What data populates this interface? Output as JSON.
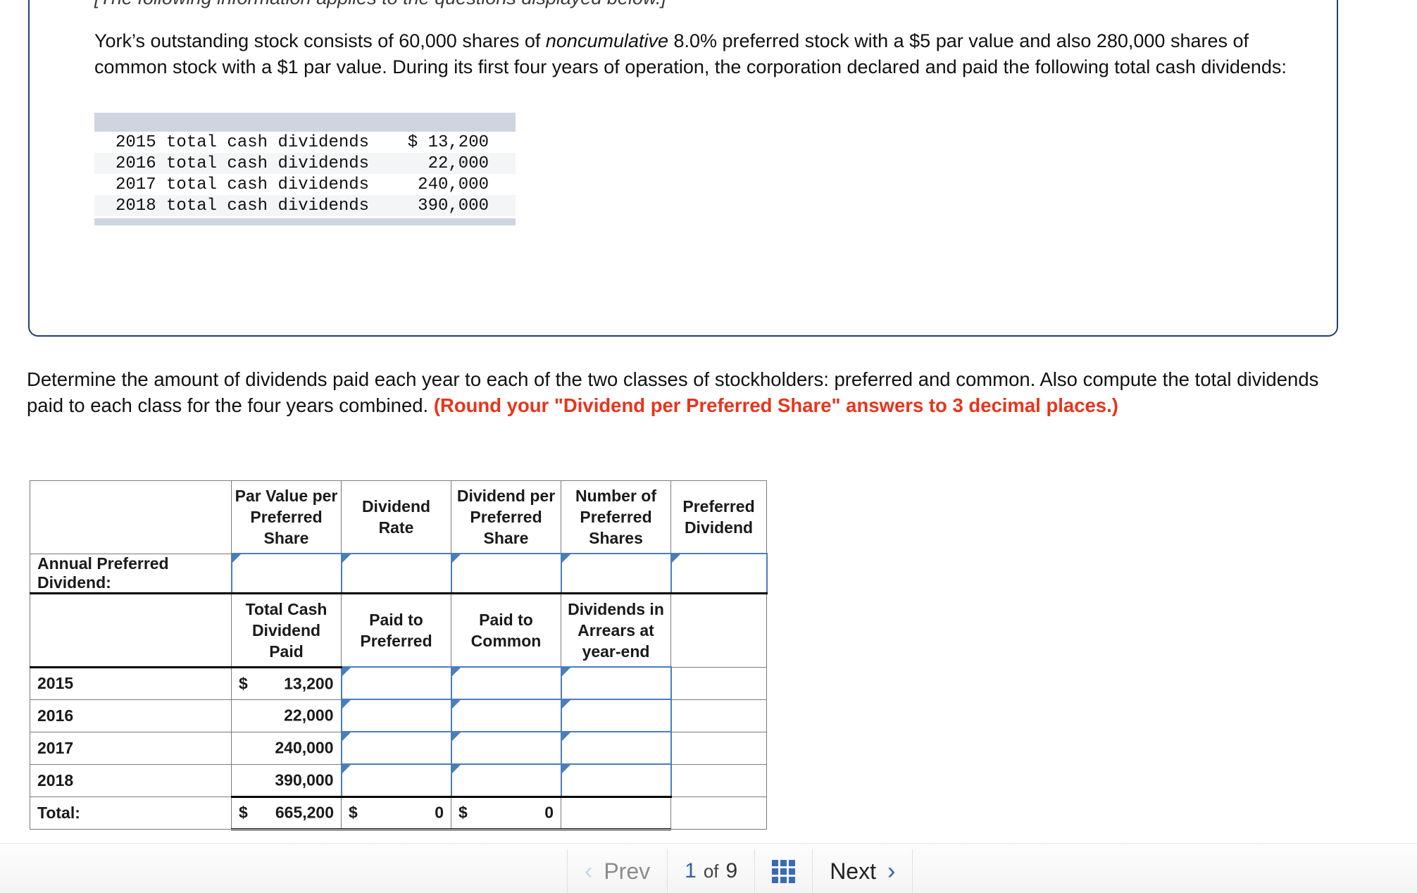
{
  "info_panel": {
    "applies_note": "[The following information applies to the questions displayed below.]",
    "paragraph_part1": "York’s outstanding stock consists of 60,000 shares of ",
    "paragraph_italic": "noncumulative",
    "paragraph_part2": " 8.0% preferred stock with a $5 par value and also 280,000 shares of common stock with a $1 par value. During its first four years of operation, the corporation declared and paid the following total cash dividends:",
    "dividends_table": {
      "rows": [
        {
          "label": "2015 total cash dividends",
          "currency": "$",
          "value": "13,200"
        },
        {
          "label": "2016 total cash dividends",
          "currency": "",
          "value": "22,000"
        },
        {
          "label": "2017 total cash dividends",
          "currency": "",
          "value": "240,000"
        },
        {
          "label": "2018 total cash dividends",
          "currency": "",
          "value": "390,000"
        }
      ]
    }
  },
  "instruction": {
    "text_part1": "Determine the amount of dividends paid each year to each of the two classes of stockholders: preferred and common. Also compute the total dividends paid to each class for the four years combined. ",
    "requirement": "(Round your \"Dividend per Preferred Share\" answers to 3 decimal places.)"
  },
  "answer_grid": {
    "header_row_1": {
      "corner": "",
      "col_par_value": "Par Value per Preferred Share",
      "col_dividend_rate": "Dividend Rate",
      "col_dividend_per_share": "Dividend per Preferred Share",
      "col_number_of_shares": "Number of Preferred Shares",
      "col_preferred_dividend": "Preferred Dividend"
    },
    "annual_row": {
      "label": "Annual Preferred Dividend:",
      "par_value": "",
      "dividend_rate": "",
      "dividend_per_share": "",
      "number_of_shares": "",
      "preferred_dividend": ""
    },
    "header_row_2": {
      "corner": "",
      "col_total_cash": "Total Cash Dividend Paid",
      "col_paid_preferred": "Paid to Preferred",
      "col_paid_common": "Paid to Common",
      "col_arrears": "Dividends in Arrears at year-end",
      "col_blank": ""
    },
    "year_rows": [
      {
        "year": "2015",
        "total_currency": "$",
        "total_value": "13,200",
        "paid_preferred": "",
        "paid_common": "",
        "arrears": ""
      },
      {
        "year": "2016",
        "total_currency": "",
        "total_value": "22,000",
        "paid_preferred": "",
        "paid_common": "",
        "arrears": ""
      },
      {
        "year": "2017",
        "total_currency": "",
        "total_value": "240,000",
        "paid_preferred": "",
        "paid_common": "",
        "arrears": ""
      },
      {
        "year": "2018",
        "total_currency": "",
        "total_value": "390,000",
        "paid_preferred": "",
        "paid_common": "",
        "arrears": ""
      }
    ],
    "total_row": {
      "label": "Total:",
      "total_currency": "$",
      "total_value": "665,200",
      "preferred_currency": "$",
      "preferred_value": "0",
      "common_currency": "$",
      "common_value": "0",
      "arrears": ""
    }
  },
  "bottom_nav": {
    "prev_label": "Prev",
    "prev_chevron": "‹",
    "current_page": "1",
    "of_label": "of",
    "total_pages": "9",
    "grid_icon": "grid-icon",
    "next_label": "Next",
    "next_chevron": "›"
  },
  "colors": {
    "panel_border": "#1f4073",
    "header_blue": "#89b0e0",
    "input_border": "#4a7ebb",
    "requirement_red": "#e8341c",
    "mono_cap": "#ced5e0",
    "nav_accent": "#2f5fa8"
  }
}
